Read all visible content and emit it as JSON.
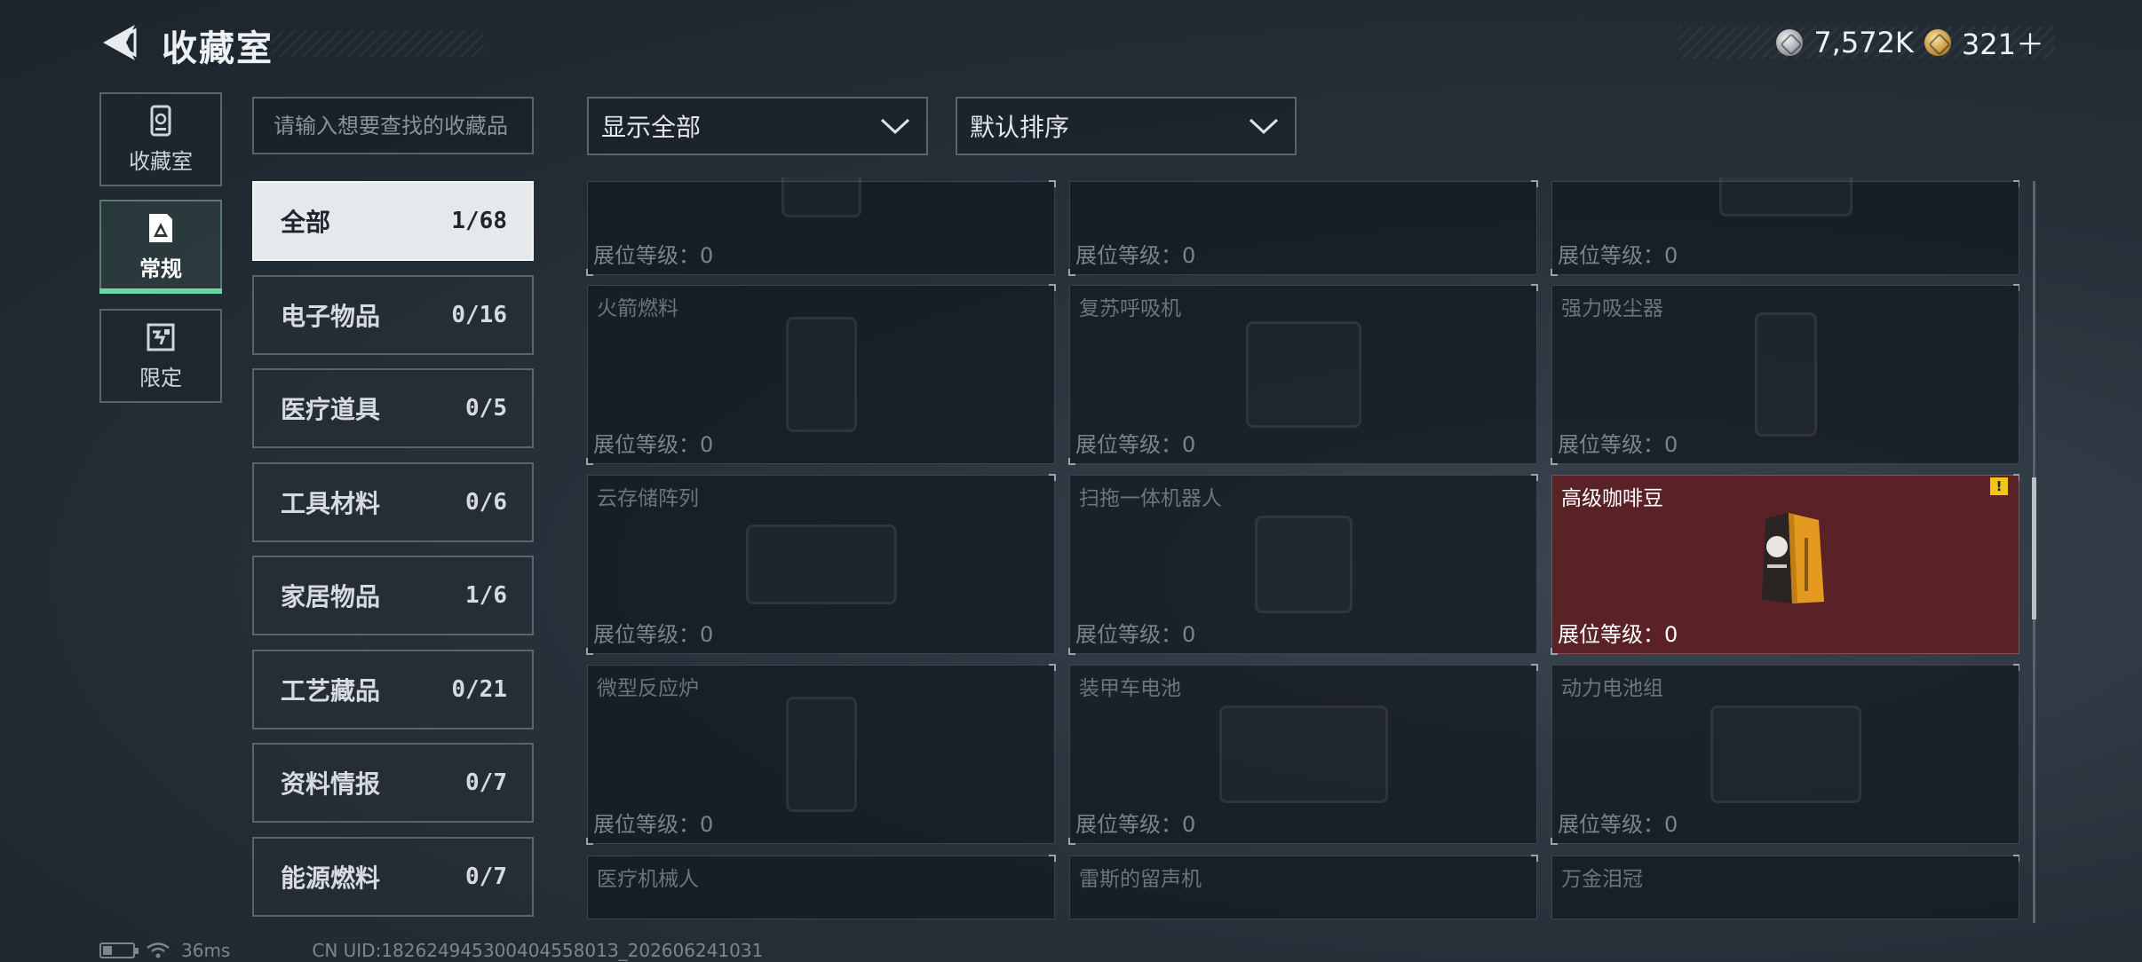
{
  "header": {
    "title": "收藏室",
    "currency": [
      {
        "icon": "silver-coin-icon",
        "value": "7,572K"
      },
      {
        "icon": "gold-coin-icon",
        "value": "321＋"
      }
    ]
  },
  "nav": {
    "items": [
      {
        "label": "收藏室",
        "icon": "collection-room-icon",
        "active": false
      },
      {
        "label": "常规",
        "icon": "regular-icon",
        "active": true
      },
      {
        "label": "限定",
        "icon": "limited-icon",
        "active": false
      }
    ]
  },
  "search": {
    "placeholder": "请输入想要查找的收藏品"
  },
  "categories": [
    {
      "name": "全部",
      "count": "1/68",
      "active": true
    },
    {
      "name": "电子物品",
      "count": "0/16"
    },
    {
      "name": "医疗道具",
      "count": "0/5"
    },
    {
      "name": "工具材料",
      "count": "0/6"
    },
    {
      "name": "家居物品",
      "count": "1/6"
    },
    {
      "name": "工艺藏品",
      "count": "0/21"
    },
    {
      "name": "资料情报",
      "count": "0/7"
    },
    {
      "name": "能源燃料",
      "count": "0/7"
    }
  ],
  "filters": {
    "show": "显示全部",
    "sort": "默认排序"
  },
  "items": [
    {
      "name": "",
      "level_label": "展位等级：0"
    },
    {
      "name": "",
      "level_label": "展位等级：0"
    },
    {
      "name": "",
      "level_label": "展位等级：0"
    },
    {
      "name": "火箭燃料",
      "level_label": "展位等级：0"
    },
    {
      "name": "复苏呼吸机",
      "level_label": "展位等级：0"
    },
    {
      "name": "强力吸尘器",
      "level_label": "展位等级：0"
    },
    {
      "name": "云存储阵列",
      "level_label": "展位等级：0"
    },
    {
      "name": "扫拖一体机器人",
      "level_label": "展位等级：0"
    },
    {
      "name": "高级咖啡豆",
      "level_label": "展位等级：0",
      "owned": true,
      "alert": "!"
    },
    {
      "name": "微型反应炉",
      "level_label": "展位等级：0"
    },
    {
      "name": "装甲车电池",
      "level_label": "展位等级：0"
    },
    {
      "name": "动力电池组",
      "level_label": "展位等级：0"
    },
    {
      "name": "医疗机械人",
      "level_label": ""
    },
    {
      "name": "雷斯的留声机",
      "level_label": ""
    },
    {
      "name": "万金泪冠",
      "level_label": ""
    }
  ],
  "status": {
    "ping": "36ms",
    "uid": "CN UID:18262494530040455801З_202606241031"
  }
}
